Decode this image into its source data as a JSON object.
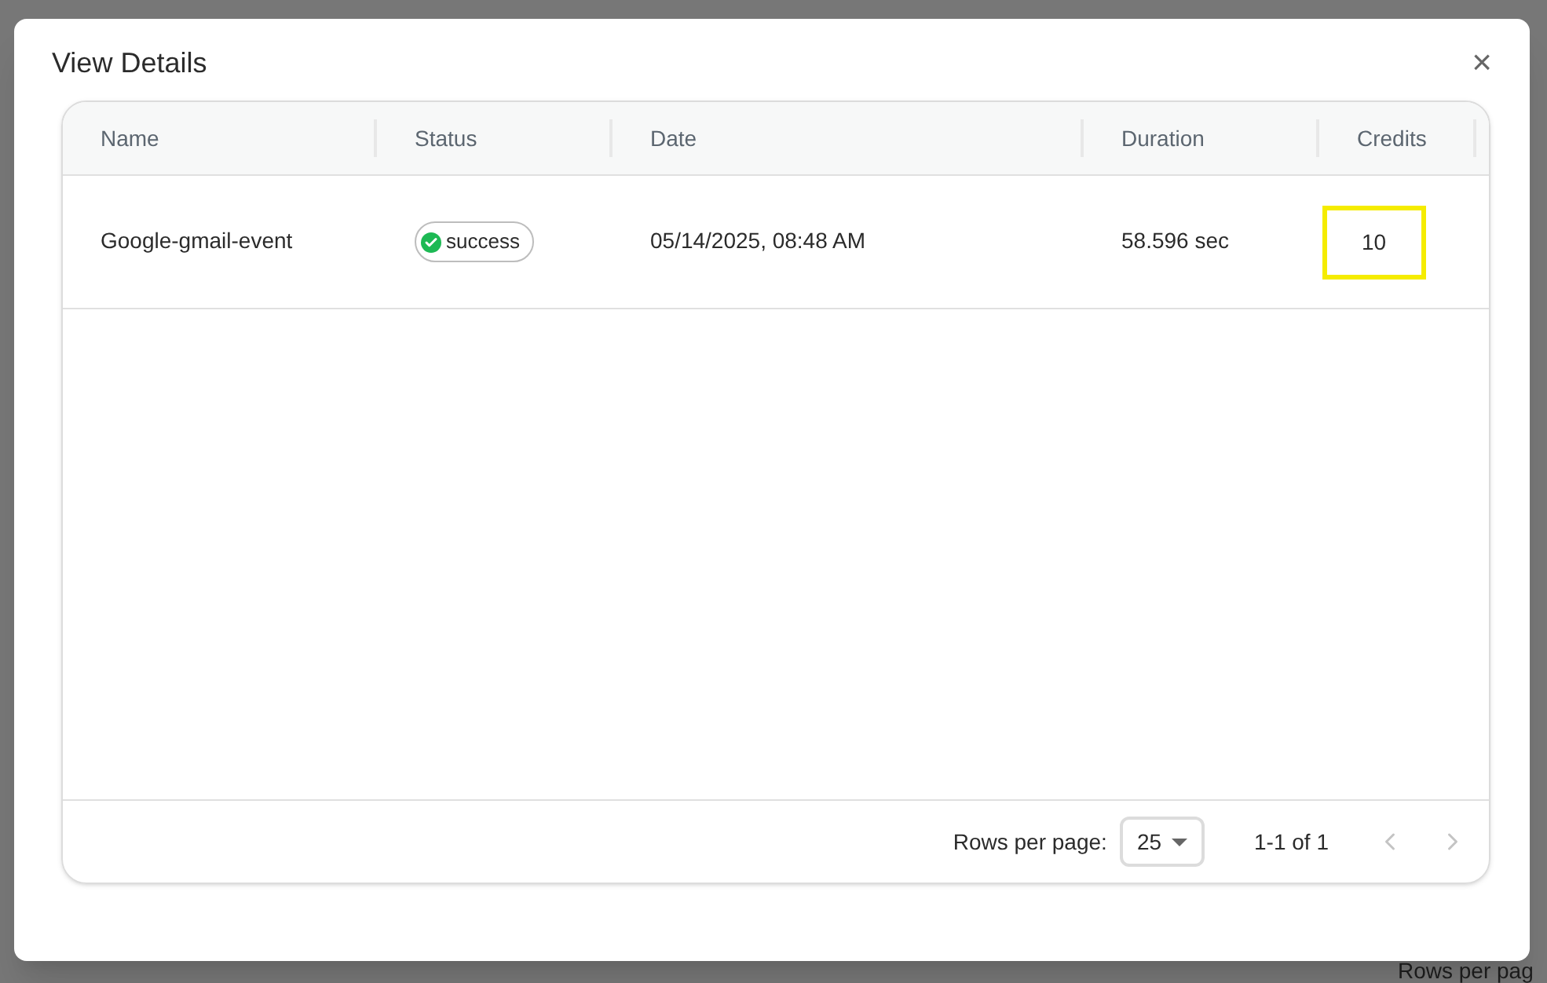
{
  "background": {
    "footer_text": "Rows per pag"
  },
  "dialog": {
    "title": "View Details",
    "close": "×"
  },
  "table": {
    "columns": [
      "Name",
      "Status",
      "Date",
      "Duration",
      "Credits"
    ],
    "rows": [
      {
        "name": "Google-gmail-event",
        "status": "success",
        "date": "05/14/2025, 08:48 AM",
        "duration": "58.596 sec",
        "credits": "10",
        "credits_highlighted": true
      }
    ],
    "pagination": {
      "rows_per_page_label": "Rows per page:",
      "rows_per_page": "25",
      "range": "1-1 of 1",
      "prev_disabled": true,
      "next_disabled": true
    }
  }
}
